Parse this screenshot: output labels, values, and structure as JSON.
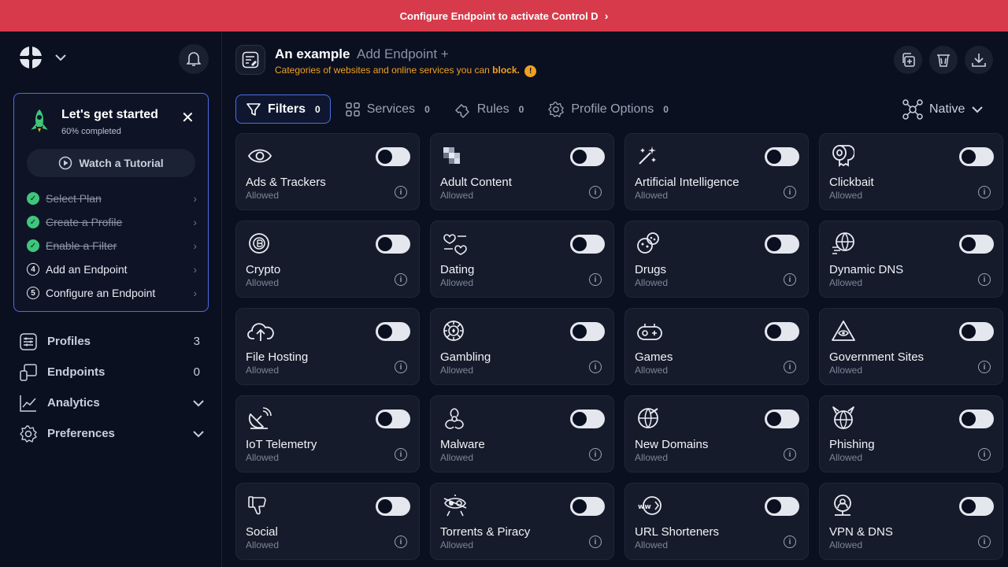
{
  "banner": {
    "text": "Configure Endpoint to activate Control D"
  },
  "sidebar": {
    "onboarding": {
      "title": "Let's get started",
      "progress": "60% completed",
      "tutorial_label": "Watch a Tutorial",
      "steps": [
        {
          "label": "Select Plan",
          "status": "done"
        },
        {
          "label": "Create a Profile",
          "status": "done"
        },
        {
          "label": "Enable a Filter",
          "status": "done"
        },
        {
          "label": "Add an Endpoint",
          "status": "todo",
          "num": "4"
        },
        {
          "label": "Configure an Endpoint",
          "status": "todo",
          "num": "5"
        }
      ]
    },
    "nav": [
      {
        "label": "Profiles",
        "count": "3"
      },
      {
        "label": "Endpoints",
        "count": "0"
      },
      {
        "label": "Analytics"
      },
      {
        "label": "Preferences"
      }
    ]
  },
  "header": {
    "profile_name": "An example",
    "add_endpoint": "Add Endpoint +",
    "subtitle_prefix": "Categories of websites and online services you can",
    "subtitle_bold": "block.",
    "info_mark": "!"
  },
  "tabs": [
    {
      "label": "Filters",
      "count": "0"
    },
    {
      "label": "Services",
      "count": "0"
    },
    {
      "label": "Rules",
      "count": "0"
    },
    {
      "label": "Profile Options",
      "count": "0"
    }
  ],
  "native_label": "Native",
  "cards": [
    {
      "name": "Ads & Trackers",
      "status": "Allowed",
      "icon": "eye-icon"
    },
    {
      "name": "Adult Content",
      "status": "Allowed",
      "icon": "pixel-icon"
    },
    {
      "name": "Artificial Intelligence",
      "status": "Allowed",
      "icon": "magic-wand-icon"
    },
    {
      "name": "Clickbait",
      "status": "Allowed",
      "icon": "toilet-paper-icon"
    },
    {
      "name": "Crypto",
      "status": "Allowed",
      "icon": "crypto-coin-icon"
    },
    {
      "name": "Dating",
      "status": "Allowed",
      "icon": "dating-icon"
    },
    {
      "name": "Drugs",
      "status": "Allowed",
      "icon": "drugs-icon"
    },
    {
      "name": "Dynamic DNS",
      "status": "Allowed",
      "icon": "globe-icon"
    },
    {
      "name": "File Hosting",
      "status": "Allowed",
      "icon": "cloud-upload-icon"
    },
    {
      "name": "Gambling",
      "status": "Allowed",
      "icon": "poker-chip-icon"
    },
    {
      "name": "Games",
      "status": "Allowed",
      "icon": "gamepad-icon"
    },
    {
      "name": "Government Sites",
      "status": "Allowed",
      "icon": "pyramid-eye-icon"
    },
    {
      "name": "IoT Telemetry",
      "status": "Allowed",
      "icon": "satellite-dish-icon"
    },
    {
      "name": "Malware",
      "status": "Allowed",
      "icon": "biohazard-icon"
    },
    {
      "name": "New Domains",
      "status": "Allowed",
      "icon": "new-globe-icon"
    },
    {
      "name": "Phishing",
      "status": "Allowed",
      "icon": "devil-globe-icon"
    },
    {
      "name": "Social",
      "status": "Allowed",
      "icon": "thumbs-down-icon"
    },
    {
      "name": "Torrents & Piracy",
      "status": "Allowed",
      "icon": "pirate-icon"
    },
    {
      "name": "URL Shorteners",
      "status": "Allowed",
      "icon": "www-icon"
    },
    {
      "name": "VPN & DNS",
      "status": "Allowed",
      "icon": "vpn-icon"
    }
  ],
  "colors": {
    "accent": "#4d6de0",
    "banner": "#d63a4b",
    "warning": "#f0a020",
    "success": "#3ec77b"
  }
}
